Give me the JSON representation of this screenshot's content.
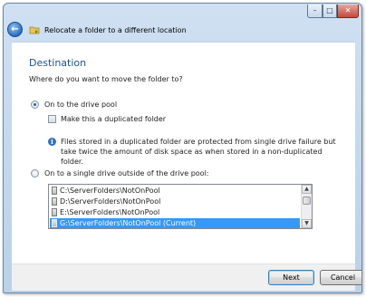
{
  "window": {
    "title": "Relocate a folder to a different location",
    "controls": {
      "minimize": "–",
      "maximize": "□",
      "close": "✕"
    },
    "back_icon": "back-arrow-icon",
    "wizard_icon": "folder-icon"
  },
  "main": {
    "heading": "Destination",
    "question": "Where do you want to move the folder to?",
    "option_pool": {
      "label": "On to the drive pool",
      "selected": true
    },
    "duplicate_checkbox": {
      "label": "Make this a duplicated folder",
      "checked": false
    },
    "info_text": "Files stored in a duplicated folder are protected from single drive failure but take twice the amount of disk space as when stored in a non-duplicated folder.",
    "option_single": {
      "label": "On to a single drive outside of the drive pool:",
      "selected": false
    },
    "drive_list": [
      {
        "path": "C:\\ServerFolders\\NotOnPool",
        "selected": false
      },
      {
        "path": "D:\\ServerFolders\\NotOnPool",
        "selected": false
      },
      {
        "path": "E:\\ServerFolders\\NotOnPool",
        "selected": false
      },
      {
        "path": "G:\\ServerFolders\\NotOnPool (Current)",
        "selected": true
      }
    ]
  },
  "footer": {
    "next_label": "Next",
    "cancel_label": "Cancel"
  }
}
